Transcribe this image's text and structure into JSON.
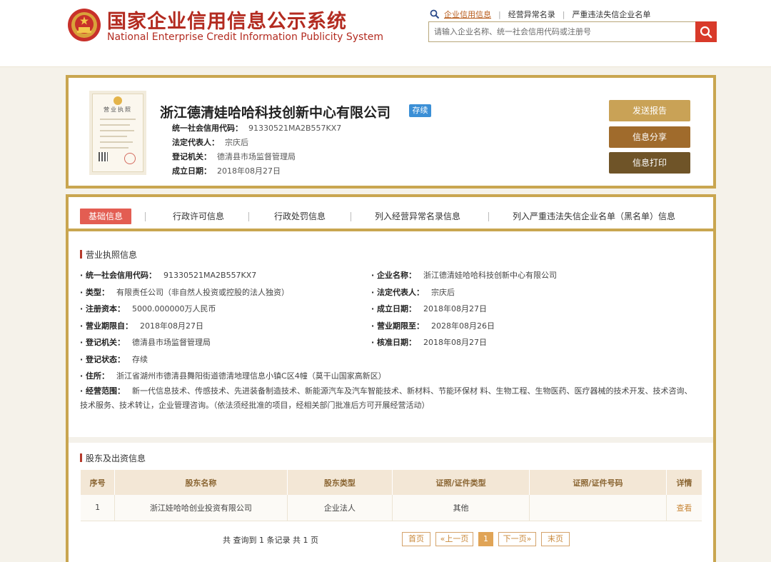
{
  "header": {
    "title_cn": "国家企业信用信息公示系统",
    "title_en": "National Enterprise Credit Information Publicity System",
    "links": [
      "企业信用信息",
      "经营异常名录",
      "严重违法失信企业名单"
    ],
    "search_placeholder": "请输入企业名称、统一社会信用代码或注册号"
  },
  "company": {
    "name": "浙江德清娃哈哈科技创新中心有限公司",
    "status_badge": "存续",
    "license_heading": "营业执照",
    "credit_code_label": "统一社会信用代码：",
    "credit_code": "91330521MA2B557KX7",
    "legal_rep_label": "法定代表人：",
    "legal_rep": "宗庆后",
    "authority_label": "登记机关：",
    "authority": "德清县市场监督管理局",
    "founded_label": "成立日期：",
    "founded": "2018年08月27日",
    "actions": [
      "发送报告",
      "信息分享",
      "信息打印"
    ]
  },
  "tabs": [
    "基础信息",
    "行政许可信息",
    "行政处罚信息",
    "列入经营异常名录信息",
    "列入严重违法失信企业名单（黑名单）信息"
  ],
  "license_section": {
    "title": "营业执照信息",
    "fields": [
      {
        "k": "· 统一社会信用代码：",
        "v": "91330521MA2B557KX7"
      },
      {
        "k": "· 企业名称：",
        "v": "浙江德清娃哈哈科技创新中心有限公司"
      },
      {
        "k": "· 类型：",
        "v": "有限责任公司（非自然人投资或控股的法人独资）"
      },
      {
        "k": "· 法定代表人：",
        "v": "宗庆后"
      },
      {
        "k": "· 注册资本：",
        "v": "5000.000000万人民币"
      },
      {
        "k": "· 成立日期：",
        "v": "2018年08月27日"
      },
      {
        "k": "· 营业期限自：",
        "v": "2018年08月27日"
      },
      {
        "k": "· 营业期限至：",
        "v": "2028年08月26日"
      },
      {
        "k": "· 登记机关：",
        "v": "德清县市场监督管理局"
      },
      {
        "k": "· 核准日期：",
        "v": "2018年08月27日"
      },
      {
        "k": "· 登记状态：",
        "v": "存续"
      },
      {
        "k": "· 住所：",
        "v": "浙江省湖州市德清县舞阳街道德清地理信息小镇C区4幢（莫干山国家高新区）"
      },
      {
        "k": "· 经营范围：",
        "v": "新一代信息技术、传感技术、先进装备制造技术、新能源汽车及汽车智能技术、新材料、节能环保材 料、生物工程、生物医药、医疗器械的技术开发、技术咨询、技术服务、技术转让，企业管理咨询。（依法须经批准的项目，经相关部门批准后方可开展经营活动）"
      }
    ]
  },
  "shareholders": {
    "title": "股东及出资信息",
    "columns": [
      "序号",
      "股东名称",
      "股东类型",
      "证照/证件类型",
      "证照/证件号码",
      "详情"
    ],
    "rows": [
      [
        "1",
        "浙江娃哈哈创业投资有限公司",
        "企业法人",
        "其他",
        "",
        "查看"
      ]
    ],
    "count_text": "共 查询到 1 条记录 共 1 页",
    "pager": [
      "首页",
      "«上一页",
      "1",
      "下一页»",
      "末页"
    ]
  },
  "colors": {
    "brand_red": "#b32b20",
    "gold_border": "#c9a650",
    "active_tab": "#e35d52",
    "badge_blue": "#3b8fd6"
  }
}
